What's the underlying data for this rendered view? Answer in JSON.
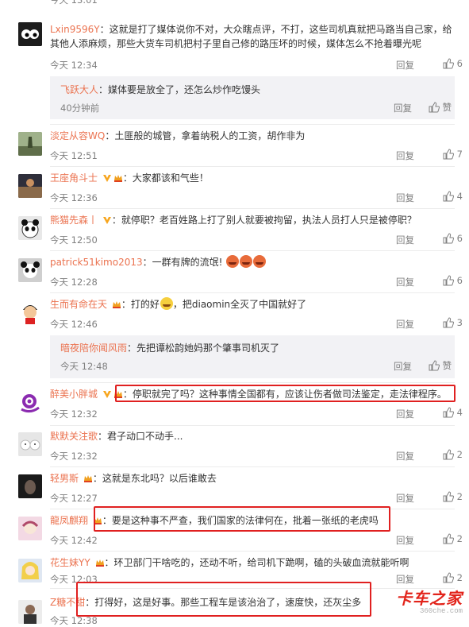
{
  "top_partial": {
    "time": "今天 13:01"
  },
  "comments": [
    {
      "user": "Lxin9596Y",
      "text": "这就是打了媒体说你不对，大众瞎点评，不打，这些司机真就把马路当自己家，给其他人添麻烦，那些大货车司机把村子里自己修的路压坏的时候，媒体怎么不抢着曝光呢",
      "time": "今天 12:34",
      "reply": "回复",
      "likes": "6"
    },
    {
      "user": "飞跃大人",
      "text": "媒体要是放全了，还怎么炒作吃馒头",
      "time": "40分钟前",
      "reply": "回复",
      "likes": "赞"
    },
    {
      "user": "淡定从容WQ",
      "text": "土匪般的城管，拿着纳税人的工资，胡作非为",
      "time": "今天 12:51",
      "reply": "回复",
      "likes": "7"
    },
    {
      "user": "王座角斗士",
      "text": "大家都该和气些！",
      "time": "今天 12:36",
      "reply": "回复",
      "likes": "4"
    },
    {
      "user": "熊猫先森丨",
      "text": "就停职？老百姓路上打了别人就要被拘留，执法人员打人只是被停职？",
      "time": "今天 12:50",
      "reply": "回复",
      "likes": "6"
    },
    {
      "user": "patrick51kimo2013",
      "text": "一群有牌的流氓!",
      "time": "今天 12:28",
      "reply": "回复",
      "likes": "6"
    },
    {
      "user": "生而有命在天",
      "text": "打的好",
      "text2": "，把diaomin全灭了中国就好了",
      "time": "今天 12:46",
      "reply": "回复",
      "likes": "3"
    },
    {
      "user": "暗夜陪你闻风雨",
      "text": "先把谭松韵她妈那个肇事司机灭了",
      "time": "今天 12:48",
      "reply": "回复",
      "likes": "赞"
    },
    {
      "user": "醉美小胖城",
      "text": "停职就完了吗？这种事情全国都有，应该让伤者做司法鉴定，走法律程序。",
      "time": "今天 12:32",
      "reply": "回复",
      "likes": "4"
    },
    {
      "user": "默默关注歌",
      "text": "君子动口不动手...",
      "time": "今天 12:32",
      "reply": "回复",
      "likes": "2"
    },
    {
      "user": "轻男斯",
      "text": "这就是东北吗？以后谁敢去",
      "time": "今天 12:27",
      "reply": "回复",
      "likes": "2"
    },
    {
      "user": "龍凤麒翔",
      "text": "要是这种事不严查，我们国家的法律何在，批着一张纸的老虎吗",
      "time": "今天 12:42",
      "reply": "回复",
      "likes": "2"
    },
    {
      "user": "花生妹YY",
      "text": "环卫部门干啥吃的，还动不听，给司机下跪啊，磕的头破血流就能听啊",
      "time": "今天 12:03",
      "reply": "回复",
      "likes": "2"
    },
    {
      "user": "Z糖不甜",
      "text": "打得好，这是好事。那些工程车是该治治了，速度快，还灰尘多",
      "time": "今天 12:38",
      "reply": "回复",
      "likes": ""
    }
  ],
  "watermark": {
    "text": "卡车之家",
    "url": "360che.com"
  },
  "colors": {
    "username": "#eb7350",
    "reply_username": "#eb7350",
    "time": "#808080",
    "highlight_box": "#e02020",
    "reply_bg": "#f2f2f5"
  }
}
